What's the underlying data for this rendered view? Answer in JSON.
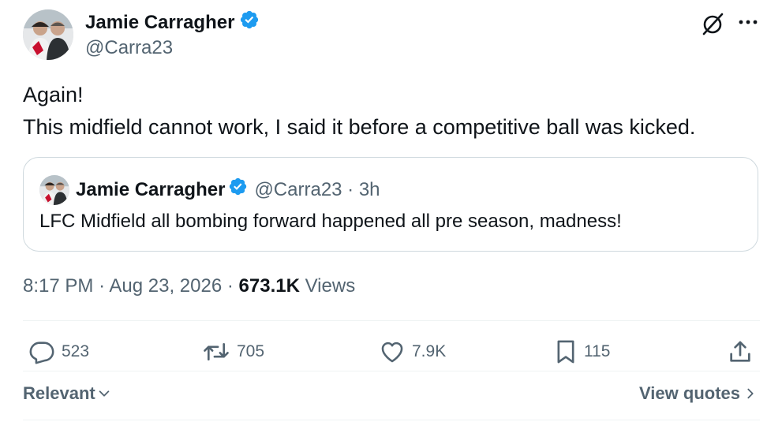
{
  "author": {
    "name": "Jamie Carragher",
    "handle": "@Carra23"
  },
  "tweet": {
    "lines": [
      "Again!",
      "This midfield cannot work, I said it before a competitive ball was kicked."
    ]
  },
  "quote": {
    "name": "Jamie Carragher",
    "handle_time": "@Carra23 · 3h",
    "text": "LFC Midfield all bombing forward happened all pre season, madness!"
  },
  "meta": {
    "time": "8:17 PM",
    "date": "Aug 23, 2026",
    "views_count": "673.1K",
    "views_label": "Views"
  },
  "actions": {
    "replies": "523",
    "reposts": "705",
    "likes": "7.9K",
    "bookmarks": "115"
  },
  "footer": {
    "sort_label": "Relevant",
    "view_quotes": "View quotes"
  },
  "colors": {
    "verified": "#1d9bf0",
    "secondary_text": "#536471",
    "border": "#cfd9de"
  }
}
